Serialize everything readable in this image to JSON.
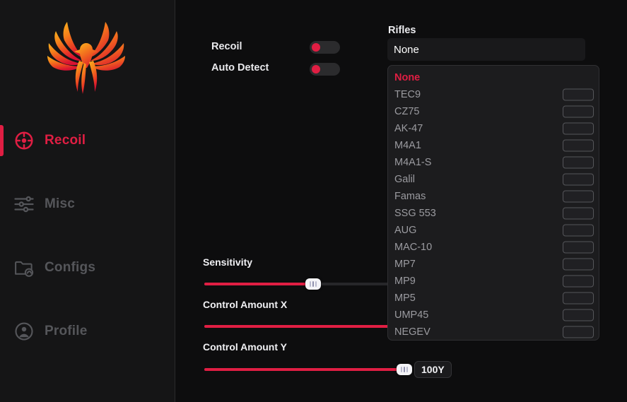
{
  "app": {
    "logo_name": "phoenix-logo",
    "accent_color": "#e01e43",
    "logo_gradient_from": "#f7a823",
    "logo_gradient_to": "#e0182e"
  },
  "sidebar": {
    "items": [
      {
        "label": "Recoil",
        "icon": "crosshair-icon",
        "active": true
      },
      {
        "label": "Misc",
        "icon": "sliders-icon",
        "active": false
      },
      {
        "label": "Configs",
        "icon": "folder-cloud-icon",
        "active": false
      },
      {
        "label": "Profile",
        "icon": "user-circle-icon",
        "active": false
      }
    ]
  },
  "main": {
    "toggles": [
      {
        "label": "Recoil",
        "on": false
      },
      {
        "label": "Auto Detect",
        "on": false
      }
    ],
    "sliders": [
      {
        "label": "Sensitivity",
        "percent": 53,
        "badge": ""
      },
      {
        "label": "Control Amount X",
        "percent": 100,
        "badge": ""
      },
      {
        "label": "Control Amount Y",
        "percent": 100,
        "badge": "100Y"
      }
    ]
  },
  "dropdown": {
    "title": "Rifles",
    "selected_value": "None",
    "options": [
      {
        "label": "None",
        "selected": true,
        "keybind": ""
      },
      {
        "label": "TEC9",
        "selected": false,
        "keybind": ""
      },
      {
        "label": "CZ75",
        "selected": false,
        "keybind": ""
      },
      {
        "label": "AK-47",
        "selected": false,
        "keybind": ""
      },
      {
        "label": "M4A1",
        "selected": false,
        "keybind": ""
      },
      {
        "label": "M4A1-S",
        "selected": false,
        "keybind": ""
      },
      {
        "label": "Galil",
        "selected": false,
        "keybind": ""
      },
      {
        "label": "Famas",
        "selected": false,
        "keybind": ""
      },
      {
        "label": "SSG 553",
        "selected": false,
        "keybind": ""
      },
      {
        "label": "AUG",
        "selected": false,
        "keybind": ""
      },
      {
        "label": "MAC-10",
        "selected": false,
        "keybind": ""
      },
      {
        "label": "MP7",
        "selected": false,
        "keybind": ""
      },
      {
        "label": "MP9",
        "selected": false,
        "keybind": ""
      },
      {
        "label": "MP5",
        "selected": false,
        "keybind": ""
      },
      {
        "label": "UMP45",
        "selected": false,
        "keybind": ""
      },
      {
        "label": "NEGEV",
        "selected": false,
        "keybind": ""
      }
    ]
  }
}
